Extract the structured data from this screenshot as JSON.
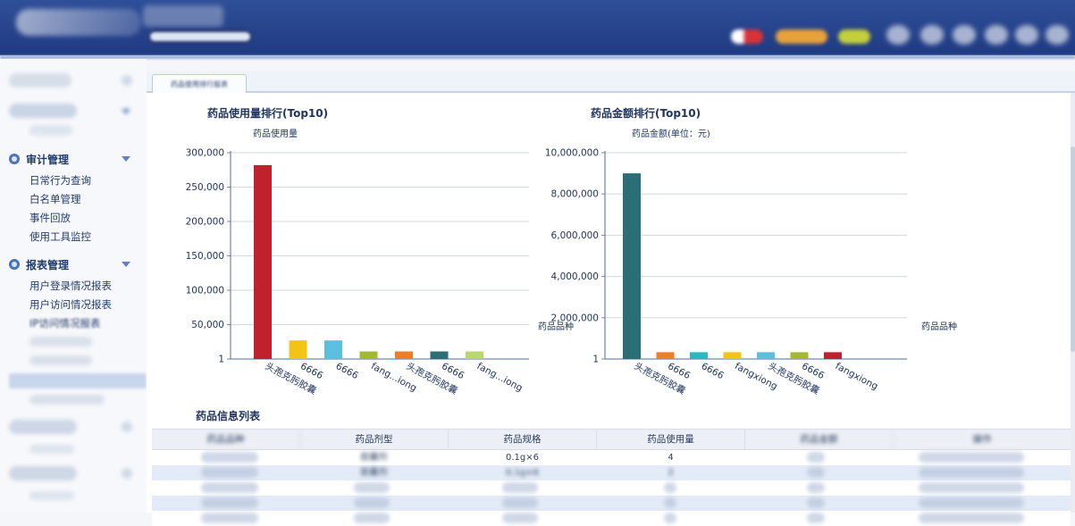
{
  "sidebar": {
    "sections": [
      {
        "title": "审计管理",
        "items": [
          "日常行为查询",
          "白名单管理",
          "事件回放",
          "使用工具监控"
        ]
      },
      {
        "title": "报表管理",
        "items": [
          "用户登录情况报表",
          "用户访问情况报表",
          "IP访问情况报表"
        ]
      }
    ]
  },
  "tab": {
    "label": "药品使用排行报表"
  },
  "charts": {
    "usage": {
      "title": "药品使用量排行(Top10)",
      "ylabel": "药品使用量",
      "xlabel": "药品品种"
    },
    "amount": {
      "title": "药品金额排行(Top10)",
      "ylabel": "药品金额(单位：元)",
      "xlabel": "药品品种"
    }
  },
  "list": {
    "title": "药品信息列表",
    "headers": [
      "药品品种",
      "药品剂型",
      "药品规格",
      "药品使用量",
      "药品金额",
      "操作"
    ],
    "rows": [
      {
        "form": "胶囊剂",
        "spec": "0.1g×6",
        "usage": "4"
      },
      {
        "form": "胶囊剂",
        "spec": "0.1g×6",
        "usage": "2"
      }
    ]
  },
  "chart_data": [
    {
      "type": "bar",
      "title": "药品使用量排行(Top10)",
      "ylabel": "药品使用量",
      "xlabel": "药品品种",
      "categories": [
        "头孢克肟胶囊",
        "6666",
        "6666",
        "fang...iong",
        "头孢克肟胶囊",
        "6666",
        "fang...iong"
      ],
      "values": [
        282000,
        27000,
        27000,
        11000,
        11000,
        11000,
        11000
      ],
      "colors": [
        "#c0212c",
        "#f3c316",
        "#5bbfde",
        "#a3b833",
        "#ef7d2a",
        "#2a6f78",
        "#b9d86c"
      ],
      "yticks": [
        "1",
        "50,000",
        "100,000",
        "150,000",
        "200,000",
        "250,000",
        "300,000"
      ],
      "ylim": [
        0,
        300000
      ],
      "grid": true
    },
    {
      "type": "bar",
      "title": "药品金额排行(Top10)",
      "ylabel": "药品金额(单位：元)",
      "xlabel": "药品品种",
      "categories": [
        "头孢克肟胶囊",
        "6666",
        "6666",
        "fangxiong",
        "头孢克肟胶囊",
        "6666",
        "fangxiong"
      ],
      "values": [
        9000000,
        330000,
        330000,
        330000,
        330000,
        330000,
        330000
      ],
      "colors": [
        "#2a6f78",
        "#ef7d2a",
        "#2bb7c2",
        "#f3c316",
        "#5bbfde",
        "#a3b833",
        "#c0212c"
      ],
      "yticks": [
        "1",
        "2,000,000",
        "4,000,000",
        "6,000,000",
        "8,000,000",
        "10,000,000"
      ],
      "ylim": [
        0,
        10000000
      ],
      "grid": true
    }
  ]
}
